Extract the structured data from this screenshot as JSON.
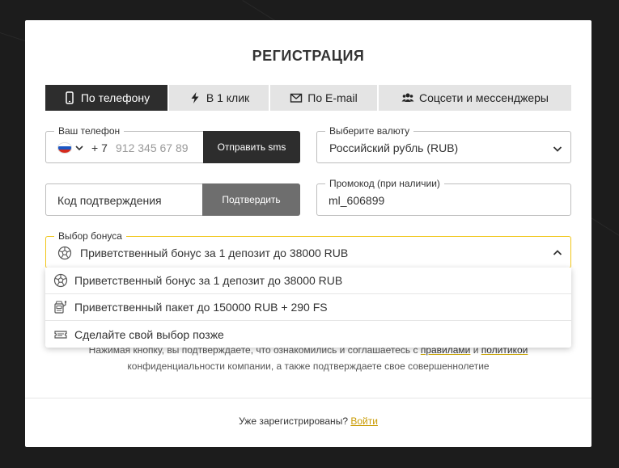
{
  "title": "РЕГИСТРАЦИЯ",
  "tabs": [
    {
      "label": "По телефону",
      "icon": "phone-icon",
      "active": true
    },
    {
      "label": "В 1 клик",
      "icon": "lightning-icon",
      "active": false
    },
    {
      "label": "По E-mail",
      "icon": "envelope-icon",
      "active": false
    },
    {
      "label": "Соцсети и мессенджеры",
      "icon": "users-icon",
      "active": false
    }
  ],
  "phone": {
    "label": "Ваш телефон",
    "country_code": "+ 7",
    "placeholder": "912 345 67 89",
    "send_sms": "Отправить sms",
    "flag_colors": [
      "#ffffff",
      "#1c57c4",
      "#d52b1e"
    ]
  },
  "currency": {
    "label": "Выберите валюту",
    "value": "Российский рубль (RUB)"
  },
  "confirm": {
    "placeholder": "Код подтверждения",
    "button": "Подтвердить"
  },
  "promo": {
    "label": "Промокод (при наличии)",
    "value": "ml_606899"
  },
  "bonus": {
    "label": "Выбор бонуса",
    "value": "Приветственный бонус за 1 депозит до 38000 RUB",
    "icon": "soccer-ball-icon",
    "options": [
      {
        "label": "Приветственный бонус за 1 депозит до 38000 RUB",
        "icon": "soccer-ball-icon"
      },
      {
        "label": "Приветственный пакет до 150000 RUB + 290 FS",
        "icon": "slot-machine-icon"
      },
      {
        "label": "Сделайте свой выбор позже",
        "icon": "ticket-icon"
      }
    ]
  },
  "consent": {
    "text_before": "Нажимая кнопку, вы подтверждаете, что ознакомились и соглашаетесь с ",
    "rules_link": "правилами",
    "and": " и ",
    "policy_link": "политикой",
    "text_after": "конфиденциальности компании, а также подтверждаете свое совершеннолетие"
  },
  "footer": {
    "question": "Уже зарегистрированы? ",
    "login_link": "Войти"
  },
  "colors": {
    "accent": "#f1c618",
    "dark": "#2d2d2d",
    "link": "#c99a00"
  }
}
